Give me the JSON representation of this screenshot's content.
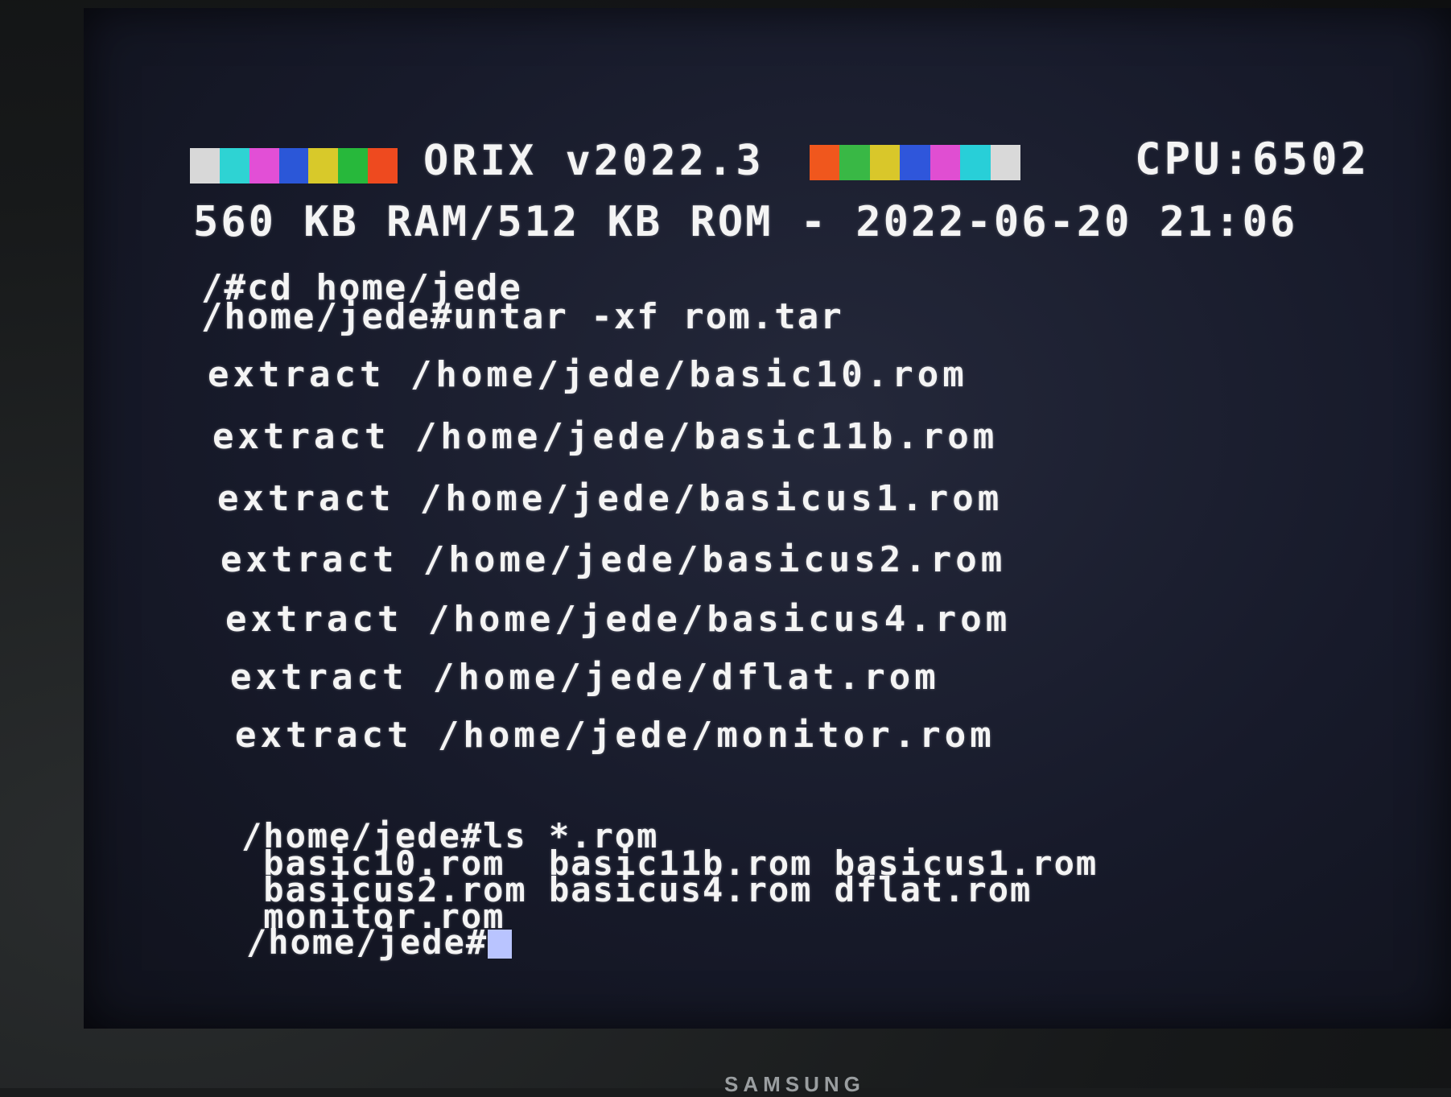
{
  "banner": {
    "title": "ORIX v2022.3",
    "cpu": "CPU:6502",
    "left_colors": [
      "#d8d8d8",
      "#2ed3d3",
      "#e24fd6",
      "#2b57d8",
      "#d8c92a",
      "#27b83b",
      "#ee4a1f"
    ],
    "right_colors": [
      "#f0571d",
      "#39b845",
      "#d9c72a",
      "#2f56db",
      "#e04ed2",
      "#28cfd8",
      "#d9d9d9"
    ]
  },
  "memory_line": "560 KB RAM/512 KB ROM - 2022-06-20 21:06",
  "commands": [
    "/#cd home/jede",
    "/home/jede#untar -xf rom.tar"
  ],
  "extract_lines": [
    "extract /home/jede/basic10.rom",
    "extract /home/jede/basic11b.rom",
    "extract /home/jede/basicus1.rom",
    "extract /home/jede/basicus2.rom",
    "extract /home/jede/basicus4.rom",
    "extract /home/jede/dflat.rom",
    "extract /home/jede/monitor.rom"
  ],
  "ls": {
    "command": "/home/jede#ls *.rom",
    "rows": [
      " basic10.rom  basic11b.rom basicus1.rom",
      " basicus2.rom basicus4.rom dflat.rom",
      " monitor.rom"
    ]
  },
  "prompt": "/home/jede#",
  "monitor_brand": "SAMSUNG"
}
